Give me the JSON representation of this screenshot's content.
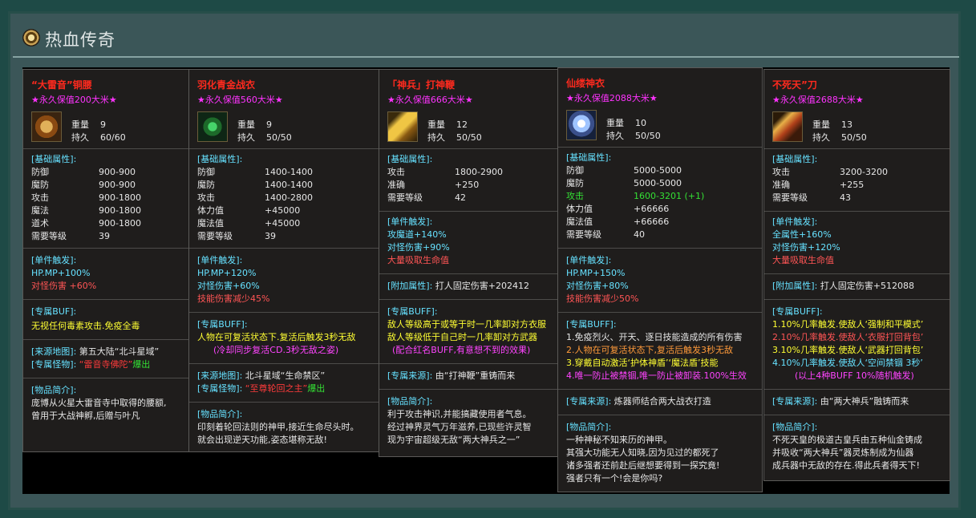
{
  "page": {
    "title": "热血传奇"
  },
  "cards": [
    {
      "name": "“大雷音”铜腰",
      "worth": "★永久保值200大米★",
      "weight_label": "重量",
      "weight": "9",
      "dur_label": "持久",
      "dur": "60/60",
      "base_title": "[基础属性]:",
      "base": [
        [
          "防御",
          "900-900"
        ],
        [
          "魔防",
          "900-900"
        ],
        [
          "攻击",
          "900-1800"
        ],
        [
          "魔法",
          "900-1800"
        ],
        [
          "道术",
          "900-1800"
        ],
        [
          "需要等级",
          "39"
        ]
      ],
      "trig_title": "[单件触发]:",
      "trig": [
        "HP.MP+100%",
        "对怪伤害 +60%"
      ],
      "excl_title": "[专属BUF]:",
      "excl": [
        "无视任何毒素攻击.免疫全毒"
      ],
      "src_map_label": "[来源地图]:",
      "src_map": "第五大陆“北斗星域”",
      "src_mon_label": "[专属怪物]:",
      "src_mon": "“雷音寺佛陀”",
      "src_mon_tail": "爆出",
      "intro_title": "[物品简介]:",
      "intro": [
        "庞博从火星大雷音寺中取得的腰额,",
        "曾用于大战神孵,后赠与叶凡"
      ],
      "accent": "#ff2a1e"
    },
    {
      "name": "羽化青金战衣",
      "worth": "★永久保值560大米★",
      "weight_label": "重量",
      "weight": "9",
      "dur_label": "持久",
      "dur": "50/50",
      "base_title": "[基础属性]:",
      "base": [
        [
          "防御",
          "1400-1400"
        ],
        [
          "魔防",
          "1400-1400"
        ],
        [
          "攻击",
          "1400-2800"
        ],
        [
          "体力值",
          "+45000"
        ],
        [
          "魔法值",
          "+45000"
        ],
        [
          "需要等级",
          "39"
        ]
      ],
      "trig_title": "[单件触发]:",
      "trig": [
        "HP.MP+120%",
        "对怪伤害+60%",
        "技能伤害减少45%"
      ],
      "excl_title": "[专属BUFF]:",
      "excl": [
        "人物在可复活状态下.复活后触发3秒无敌",
        "(冷却同步复活CD.3秒无敌之姿)"
      ],
      "src_map_label": "[来源地图]:",
      "src_map": "北斗星域“生命禁区”",
      "src_mon_label": "[专属怪物]:",
      "src_mon": "“至尊轮回之主”",
      "src_mon_tail": "爆出",
      "intro_title": "[物品简介]:",
      "intro": [
        "印刻着轮回法则的神甲,接近生命尽头时。",
        "就会出现逆天功能,姿态堪称无敌!"
      ],
      "accent": "#ff2a1e"
    },
    {
      "name": "「神兵」打神鞭",
      "worth": "★永久保值666大米★",
      "weight_label": "重量",
      "weight": "12",
      "dur_label": "持久",
      "dur": "50/50",
      "base_title": "[基础属性]:",
      "base": [
        [
          "攻击",
          "1800-2900"
        ],
        [
          "准确",
          "+250"
        ],
        [
          "需要等级",
          "42"
        ]
      ],
      "trig_title": "[单件触发]:",
      "trig": [
        "攻魔道+140%",
        "对怪伤害+90%",
        "大量吸取生命值"
      ],
      "add_label": "[附加属性]:",
      "add": "打人固定伤害+202412",
      "excl_title": "[专属BUFF]:",
      "excl": [
        "敌人等级高于或等于时一几率卸对方衣服",
        "敌人等级低于自己时一几率卸对方武器",
        "(配合红名BUFF,有意想不到的效果)"
      ],
      "src_label": "[专属来源]:",
      "src": "由“打神鞭”重铸而来",
      "intro_title": "[物品简介]:",
      "intro": [
        "利于攻击神识,并能搞藏使用者气息。",
        "经过神界灵气万年滋养,已现些许灵智",
        "现为宇宙超级无敌“两大神兵之一”"
      ],
      "accent": "#ff2a1e"
    },
    {
      "name": "仙缕神衣",
      "worth": "★永久保值2088大米★",
      "weight_label": "重量",
      "weight": "10",
      "dur_label": "持久",
      "dur": "50/50",
      "base_title": "[基础属性]:",
      "base": [
        [
          "防御",
          "5000-5000"
        ],
        [
          "魔防",
          "5000-5000"
        ],
        [
          "攻击",
          "1600-3201 (+1)"
        ],
        [
          "体力值",
          "+66666"
        ],
        [
          "魔法值",
          "+66666"
        ],
        [
          "需要等级",
          "40"
        ]
      ],
      "trig_title": "[单件触发]:",
      "trig": [
        "HP.MP+150%",
        "对怪伤害+80%",
        "技能伤害减少50%"
      ],
      "excl_title": "[专属BUFF]:",
      "excl": [
        "1.免疫烈火、开天、逐日技能造成的所有伤害",
        "2.人物在可复活状态下,复活后触发3秒无敌",
        "3.穿戴自动激活‘护体神盾’‘魔法盾’技能",
        "4.唯一防止被禁锢,唯一防止被卸装.100%生效"
      ],
      "src_label": "[专属来源]:",
      "src": "炼器师结合两大战衣打造",
      "intro_title": "[物品简介]:",
      "intro": [
        "一种神秘不知来历的神甲。",
        "其强大功能无人知晓,因为见过的都死了",
        "诸多强者还前赴后继想要得到一探究竟!",
        "强者只有一个!会是你吗?"
      ],
      "accent": "#ff2a1e"
    },
    {
      "name": "不死天”刀",
      "worth": "★永久保值2688大米★",
      "weight_label": "重量",
      "weight": "13",
      "dur_label": "持久",
      "dur": "50/50",
      "base_title": "[基础属性]:",
      "base": [
        [
          "攻击",
          "3200-3200"
        ],
        [
          "准确",
          "+255"
        ],
        [
          "需要等级",
          "43"
        ]
      ],
      "trig_title": "[单件触发]:",
      "trig": [
        "全属性+160%",
        "对怪伤害+120%",
        "大量吸取生命值"
      ],
      "add_label": "[附加属性]:",
      "add": "打人固定伤害+512088",
      "excl_title": "[专属BUFF]:",
      "excl": [
        "1.10%几率触发.使敌人‘强制和平模式’",
        "2.10%几率触发.使敌人‘衣服打回背包’",
        "3.10%几率触发.使敌人‘武器打回背包’",
        "4.10%几率触发.使敌人‘空间禁锢 3秒’",
        "(以上4种BUFF 10%随机触发)"
      ],
      "src_label": "[专属来源]:",
      "src": "由“两大神兵”融铸而来",
      "intro_title": "[物品简介]:",
      "intro": [
        "不死天皇的极道古皇兵由五种仙金铸成",
        "并吸收“两大神兵”器灵炼制成为仙器",
        "成兵器中无敌的存在.得此兵者得天下!"
      ],
      "accent": "#ff2a1e"
    }
  ]
}
